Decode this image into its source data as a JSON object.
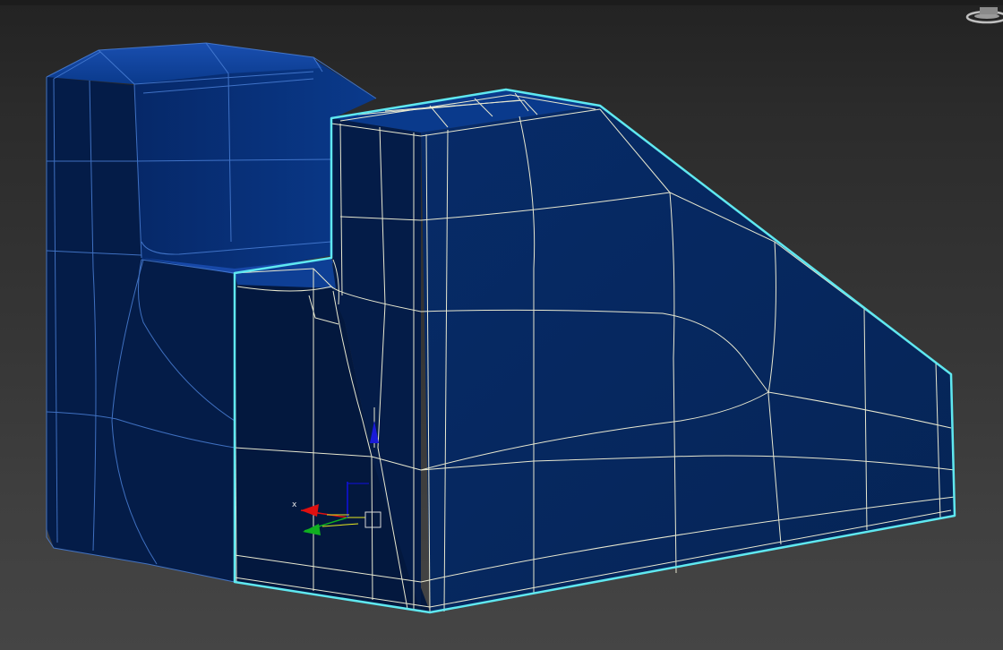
{
  "viewport": {
    "background_top": "#232323",
    "background_bottom": "#454545"
  },
  "model": {
    "back_block_color": "#0a3a8c",
    "front_block_color": "#062a62",
    "wire_color_back": "#4a7fd6",
    "wire_color_front": "#e8e8d0",
    "selection_outline_color": "#5fe8f0"
  },
  "gizmo": {
    "axis_x_label": "x",
    "axis_x_color": "#e01010",
    "axis_y_color": "#10b020",
    "axis_z_color": "#1010e0"
  },
  "viewcube_icon": "viewcube-icon"
}
